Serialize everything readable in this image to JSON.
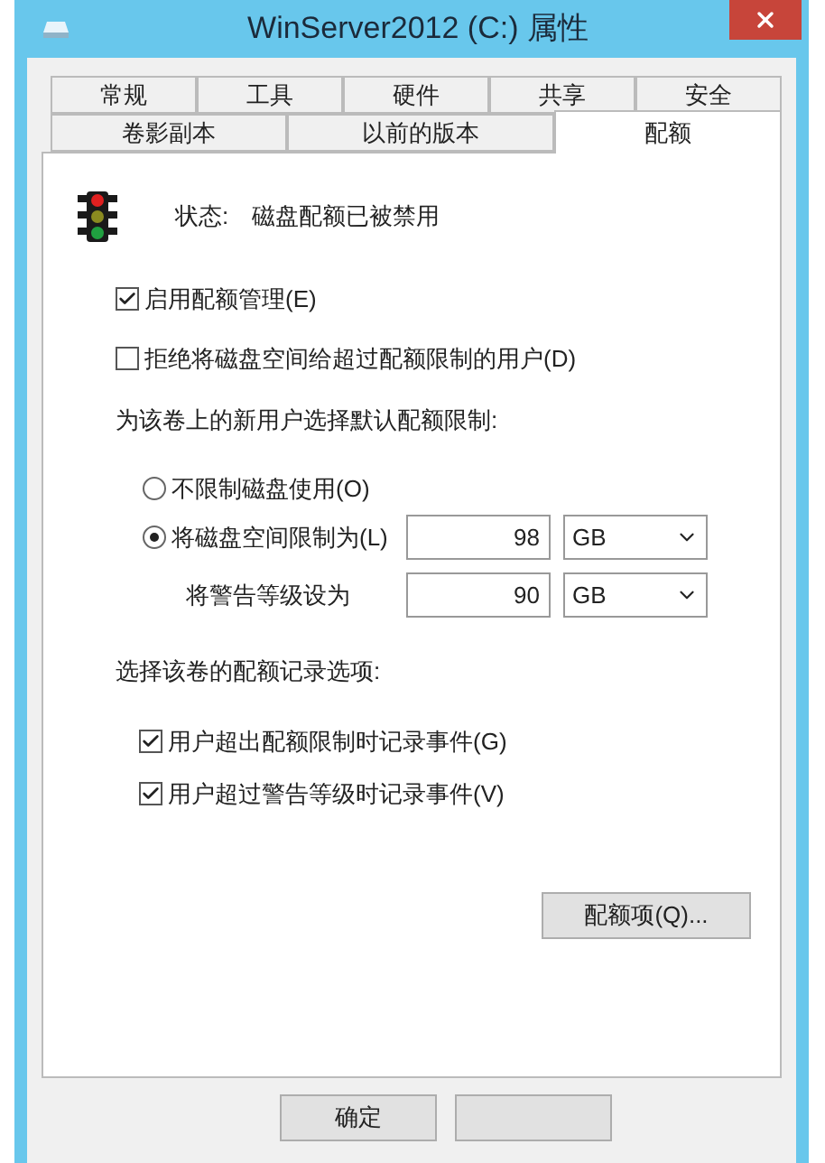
{
  "window": {
    "title": "WinServer2012 (C:) 属性"
  },
  "tab_rows": [
    [
      {
        "label": "常规",
        "selected": false
      },
      {
        "label": "工具",
        "selected": false
      },
      {
        "label": "硬件",
        "selected": false
      },
      {
        "label": "共享",
        "selected": false
      },
      {
        "label": "安全",
        "selected": false
      }
    ],
    [
      {
        "label": "卷影副本",
        "selected": false
      },
      {
        "label": "以前的版本",
        "selected": false
      },
      {
        "label": "配额",
        "selected": true
      }
    ]
  ],
  "status": {
    "label": "状态:",
    "value": "磁盘配额已被禁用"
  },
  "options": [
    {
      "label": "启用配额管理(E)",
      "checked": true
    },
    {
      "label": "拒绝将磁盘空间给超过配额限制的用户(D)",
      "checked": false
    }
  ],
  "default_limit": {
    "heading": "为该卷上的新用户选择默认配额限制:",
    "radios": [
      {
        "label": "不限制磁盘使用(O)",
        "selected": false
      },
      {
        "label": "将磁盘空间限制为(L)",
        "selected": true
      }
    ],
    "limit": {
      "value": "98",
      "unit": "GB"
    },
    "warning": {
      "label": "将警告等级设为",
      "value": "90",
      "unit": "GB"
    }
  },
  "logging": {
    "heading": "选择该卷的配额记录选项:",
    "options": [
      {
        "label": "用户超出配额限制时记录事件(G)",
        "checked": true
      },
      {
        "label": "用户超过警告等级时记录事件(V)",
        "checked": true
      }
    ]
  },
  "quota_button": "配额项(Q)...",
  "ok_button": "确定"
}
